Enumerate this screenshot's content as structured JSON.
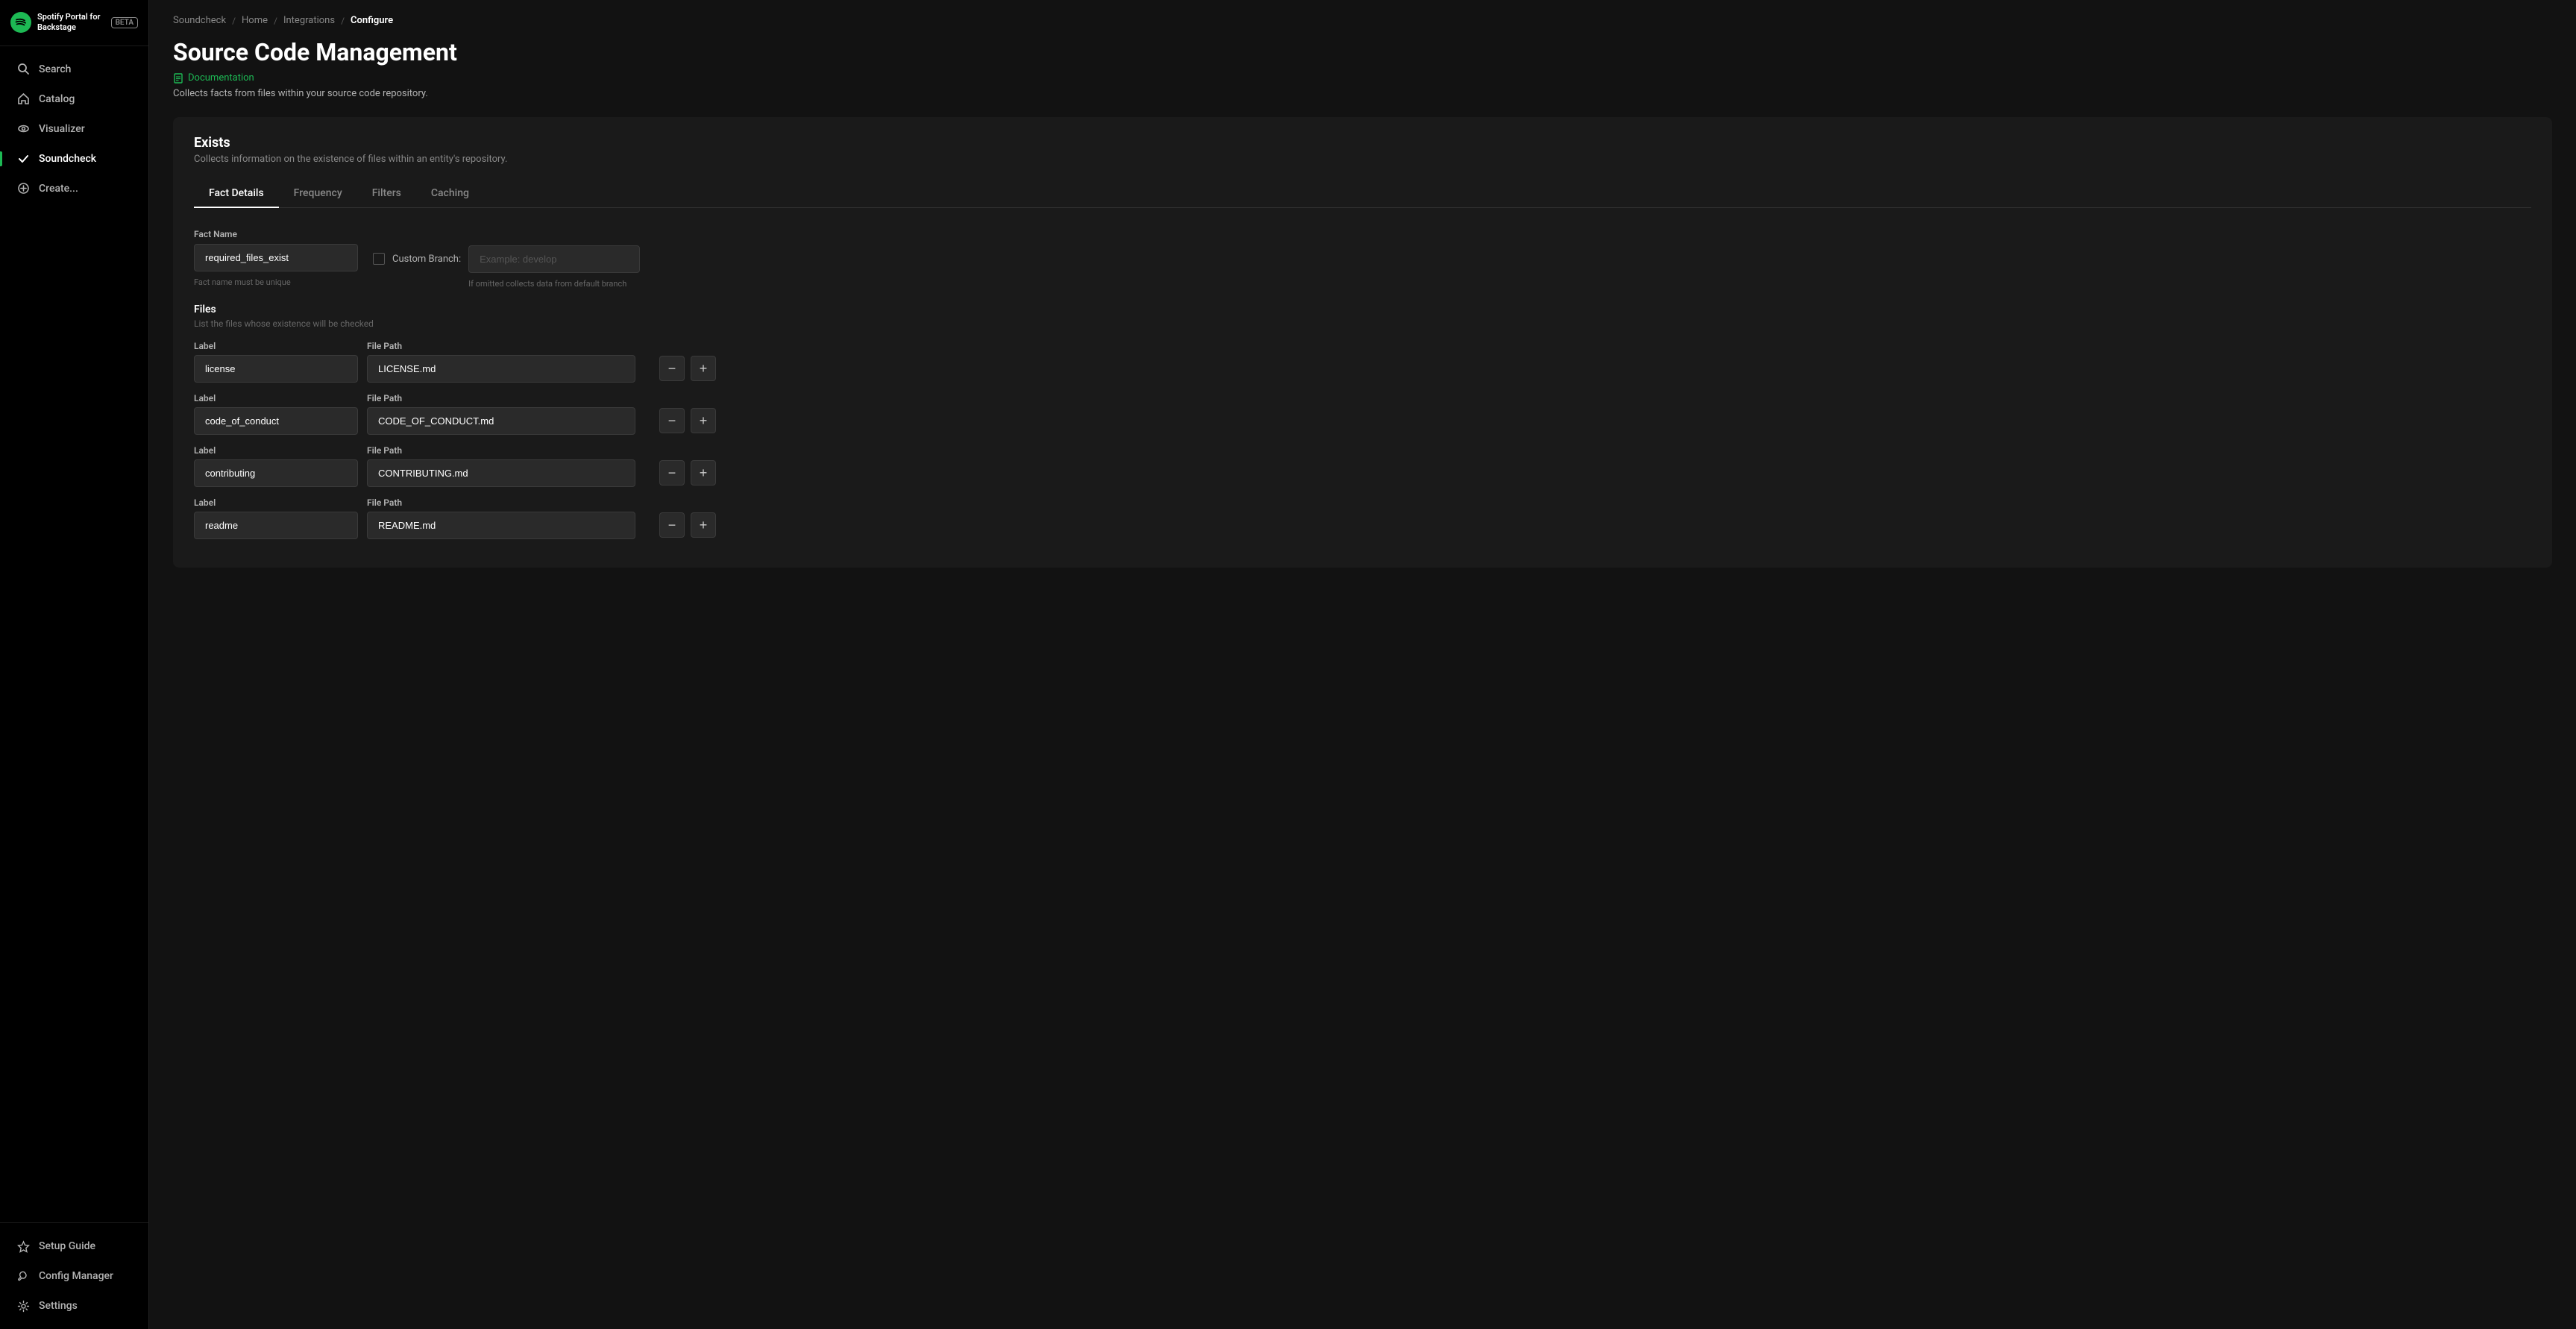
{
  "app": {
    "logo_text": "Spotify Portal for Backstage",
    "beta_label": "BETA"
  },
  "sidebar": {
    "items": [
      {
        "id": "search",
        "label": "Search",
        "icon": "🔍",
        "active": false
      },
      {
        "id": "catalog",
        "label": "Catalog",
        "icon": "🏠",
        "active": false
      },
      {
        "id": "visualizer",
        "label": "Visualizer",
        "icon": "👁",
        "active": false
      },
      {
        "id": "soundcheck",
        "label": "Soundcheck",
        "icon": "✓",
        "active": true
      },
      {
        "id": "create",
        "label": "Create...",
        "icon": "➕",
        "active": false
      }
    ],
    "bottom_items": [
      {
        "id": "setup-guide",
        "label": "Setup Guide",
        "icon": "⭐"
      },
      {
        "id": "config-manager",
        "label": "Config Manager",
        "icon": "🔧"
      },
      {
        "id": "settings",
        "label": "Settings",
        "icon": "⚙"
      }
    ]
  },
  "breadcrumb": {
    "items": [
      {
        "label": "Soundcheck",
        "active": false
      },
      {
        "label": "Home",
        "active": false
      },
      {
        "label": "Integrations",
        "active": false
      },
      {
        "label": "Configure",
        "active": true
      }
    ]
  },
  "page": {
    "title": "Source Code Management",
    "docs_label": "Documentation",
    "description": "Collects facts from files within your source code repository."
  },
  "section": {
    "title": "Exists",
    "subtitle": "Collects information on the existence of files within an entity's repository."
  },
  "tabs": [
    {
      "id": "fact-details",
      "label": "Fact Details",
      "active": true
    },
    {
      "id": "frequency",
      "label": "Frequency",
      "active": false
    },
    {
      "id": "filters",
      "label": "Filters",
      "active": false
    },
    {
      "id": "caching",
      "label": "Caching",
      "active": false
    }
  ],
  "form": {
    "fact_name_label": "Fact Name",
    "fact_name_value": "required_files_exist",
    "fact_name_hint": "Fact name must be unique",
    "custom_branch_label": "Custom Branch:",
    "custom_branch_placeholder": "Example: develop",
    "custom_branch_hint": "If omitted collects data from default branch",
    "custom_branch_checked": false
  },
  "files": {
    "title": "Files",
    "subtitle": "List the files whose existence will be checked",
    "label_column": "Label",
    "path_column": "File Path",
    "rows": [
      {
        "label": "license",
        "path": "LICENSE.md"
      },
      {
        "label": "code_of_conduct",
        "path": "CODE_OF_CONDUCT.md"
      },
      {
        "label": "contributing",
        "path": "CONTRIBUTING.md"
      },
      {
        "label": "readme",
        "path": "README.md"
      }
    ]
  }
}
